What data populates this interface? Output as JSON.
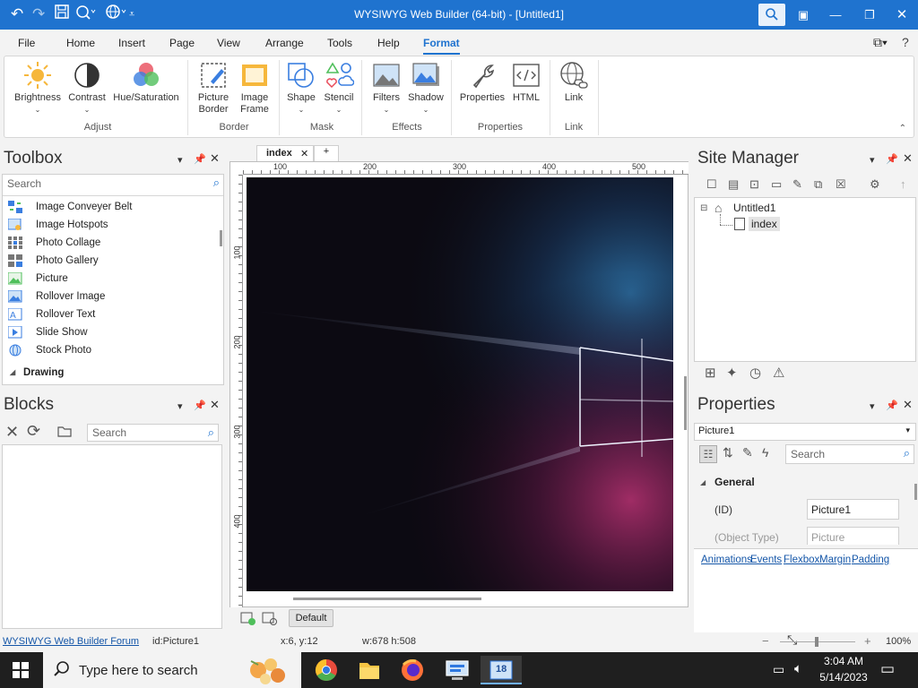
{
  "app": {
    "title": "WYSIWYG Web Builder (64-bit) - [Untitled1]"
  },
  "titlebar": {
    "qa_icons": [
      "undo-icon",
      "redo-icon",
      "save-icon",
      "preview-icon",
      "publish-icon",
      "customize-icon"
    ],
    "window_buttons": [
      "ribbon-display-icon",
      "minimize-icon",
      "restore-icon",
      "close-icon"
    ]
  },
  "menu": {
    "tabs": [
      "File",
      "Home",
      "Insert",
      "Page",
      "View",
      "Arrange",
      "Tools",
      "Help",
      "Format"
    ],
    "active": "Format"
  },
  "ribbon": {
    "buttons": {
      "brightness": "Brightness",
      "contrast": "Contrast",
      "hue": "Hue/Saturation",
      "picture_border": "Picture Border",
      "image_frame": "Image Frame",
      "shape": "Shape",
      "stencil": "Stencil",
      "filters": "Filters",
      "shadow": "Shadow",
      "properties": "Properties",
      "html": "HTML",
      "link": "Link"
    },
    "groups": {
      "adjust": "Adjust",
      "border": "Border",
      "mask": "Mask",
      "effects": "Effects",
      "properties": "Properties",
      "link": "Link"
    }
  },
  "toolbox": {
    "title": "Toolbox",
    "search_placeholder": "Search",
    "items": [
      "Image Conveyer Belt",
      "Image Hotspots",
      "Photo Collage",
      "Photo Gallery",
      "Picture",
      "Rollover Image",
      "Rollover Text",
      "Slide Show",
      "Stock Photo"
    ],
    "category": "Drawing"
  },
  "blocks": {
    "title": "Blocks",
    "search_placeholder": "Search"
  },
  "canvas": {
    "tab": "index",
    "add_tab": "+",
    "ruler_h": [
      "100",
      "200",
      "300",
      "400",
      "500"
    ],
    "ruler_v": [
      "100",
      "200",
      "300",
      "400"
    ],
    "default_button": "Default"
  },
  "site_manager": {
    "title": "Site Manager",
    "root": "Untitled1",
    "page": "index"
  },
  "properties": {
    "title": "Properties",
    "selected_object": "Picture1",
    "search_placeholder": "Search",
    "section": "General",
    "rows": [
      {
        "label": "(ID)",
        "value": "Picture1"
      },
      {
        "label": "(Object Type)",
        "value": "Picture"
      }
    ],
    "links": [
      "Animations",
      "Events",
      "Flexbox",
      "Margin",
      "Padding"
    ]
  },
  "status": {
    "forum_link": "WYSIWYG Web Builder Forum",
    "id": "id:Picture1",
    "coords": "x:6, y:12",
    "size": "w:678 h:508",
    "zoom": "100%"
  },
  "taskbar": {
    "search_placeholder": "Type here to search",
    "time": "3:04 AM",
    "date": "5/14/2023",
    "app_badge": "18"
  },
  "colors": {
    "accent": "#1f73cf",
    "taskbar": "#1f1f1f"
  }
}
